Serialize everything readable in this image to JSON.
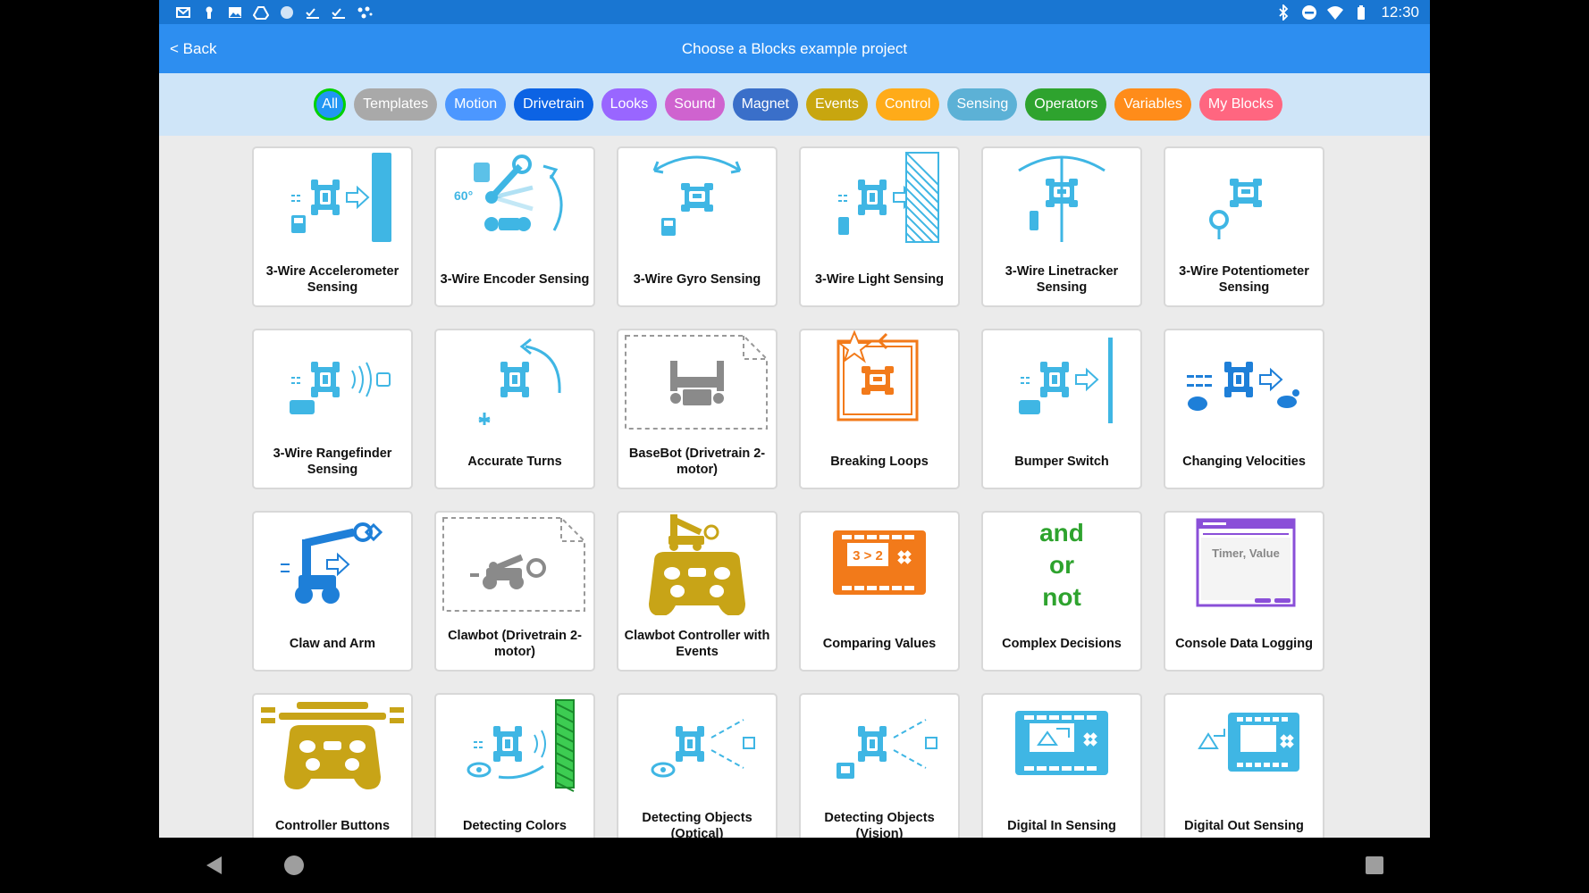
{
  "status_bar": {
    "left_icons": [
      "gmail-icon",
      "keyhole-icon",
      "image-icon",
      "drive-icon",
      "circle-icon",
      "checklist-icon",
      "checklist-icon",
      "dots-icon"
    ],
    "right_icons": [
      "bluetooth-icon",
      "do-not-disturb-icon",
      "wifi-icon",
      "battery-icon"
    ],
    "time": "12:30"
  },
  "app_bar": {
    "back_label": "< Back",
    "title": "Choose a Blocks example project"
  },
  "categories": [
    {
      "label": "All",
      "color": "#2196f3"
    },
    {
      "label": "Templates",
      "color": "#a9a9a9"
    },
    {
      "label": "Motion",
      "color": "#4c97ff"
    },
    {
      "label": "Drivetrain",
      "color": "#0c63e4"
    },
    {
      "label": "Looks",
      "color": "#9966ff"
    },
    {
      "label": "Sound",
      "color": "#cf63cf"
    },
    {
      "label": "Magnet",
      "color": "#3a6fc9"
    },
    {
      "label": "Events",
      "color": "#c8a60f"
    },
    {
      "label": "Control",
      "color": "#ffab19"
    },
    {
      "label": "Sensing",
      "color": "#5cb1d6"
    },
    {
      "label": "Operators",
      "color": "#2ea32e"
    },
    {
      "label": "Variables",
      "color": "#ff8c1a"
    },
    {
      "label": "My Blocks",
      "color": "#ff6680"
    }
  ],
  "projects": [
    {
      "label": "3-Wire Accelerometer Sensing",
      "icon": "accelerometer-icon"
    },
    {
      "label": "3-Wire Encoder Sensing",
      "icon": "encoder-icon"
    },
    {
      "label": "3-Wire Gyro Sensing",
      "icon": "gyro-icon"
    },
    {
      "label": "3-Wire Light Sensing",
      "icon": "light-sensor-icon"
    },
    {
      "label": "3-Wire Linetracker Sensing",
      "icon": "linetracker-icon"
    },
    {
      "label": "3-Wire Potentiometer Sensing",
      "icon": "potentiometer-icon"
    },
    {
      "label": "3-Wire Rangefinder Sensing",
      "icon": "rangefinder-icon"
    },
    {
      "label": "Accurate Turns",
      "icon": "turn-icon"
    },
    {
      "label": "BaseBot (Drivetrain 2-motor)",
      "icon": "basebot-icon"
    },
    {
      "label": "Breaking Loops",
      "icon": "loop-icon"
    },
    {
      "label": "Bumper Switch",
      "icon": "bumper-icon"
    },
    {
      "label": "Changing Velocities",
      "icon": "velocity-icon"
    },
    {
      "label": "Claw and Arm",
      "icon": "claw-arm-icon"
    },
    {
      "label": "Clawbot (Drivetrain 2-motor)",
      "icon": "clawbot-icon"
    },
    {
      "label": "Clawbot Controller with Events",
      "icon": "controller-events-icon"
    },
    {
      "label": "Comparing Values",
      "icon": "brain-compare-icon"
    },
    {
      "label": "Complex Decisions",
      "icon": "and-or-not-icon"
    },
    {
      "label": "Console Data Logging",
      "icon": "console-icon"
    },
    {
      "label": "Controller Buttons",
      "icon": "controller-icon"
    },
    {
      "label": "Detecting Colors",
      "icon": "color-sensor-icon"
    },
    {
      "label": "Detecting Objects (Optical)",
      "icon": "optical-icon"
    },
    {
      "label": "Detecting Objects (Vision)",
      "icon": "vision-icon"
    },
    {
      "label": "Digital In Sensing",
      "icon": "digital-in-icon"
    },
    {
      "label": "Digital Out Sensing",
      "icon": "digital-out-icon"
    }
  ],
  "icon_text": {
    "encoder_angle": "60°",
    "compare": "3 > 2",
    "and": "and",
    "or": "or",
    "not": "not",
    "console_text": "Timer, Value"
  },
  "nav": [
    "back-icon",
    "home-icon",
    "recents-icon"
  ]
}
